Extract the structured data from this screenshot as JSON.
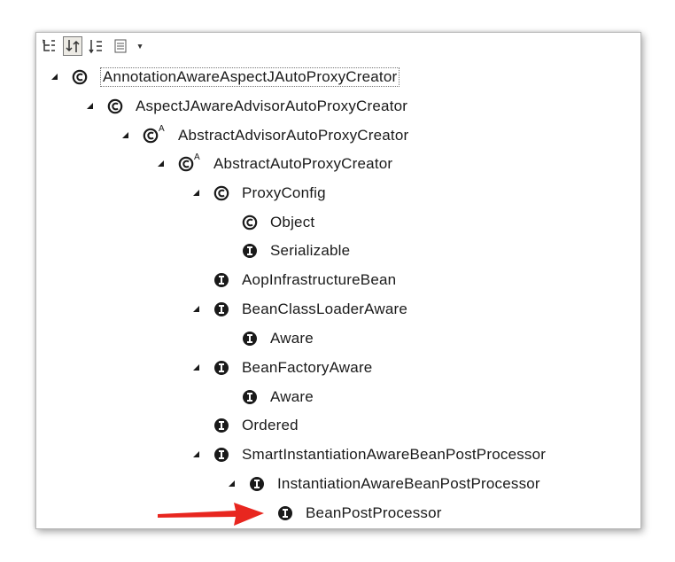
{
  "toolbar": {
    "buttons": [
      "show-qualified-names",
      "sort",
      "hide-non-public",
      "filter",
      "view-menu"
    ],
    "dropdown_glyph": "▾"
  },
  "tree": [
    {
      "label": "AnnotationAwareAspectJAutoProxyCreator",
      "icon": "class-icon",
      "expanded": true,
      "selected": true
    },
    {
      "label": "AspectJAwareAdvisorAutoProxyCreator",
      "icon": "class-icon",
      "expanded": true
    },
    {
      "label": "AbstractAdvisorAutoProxyCreator",
      "icon": "abstract-class-icon",
      "expanded": true
    },
    {
      "label": "AbstractAutoProxyCreator",
      "icon": "abstract-class-icon",
      "expanded": true
    },
    {
      "label": "ProxyConfig",
      "icon": "class-icon",
      "expanded": true
    },
    {
      "label": "Object",
      "icon": "class-icon"
    },
    {
      "label": "Serializable",
      "icon": "interface-icon"
    },
    {
      "label": "AopInfrastructureBean",
      "icon": "interface-icon"
    },
    {
      "label": "BeanClassLoaderAware",
      "icon": "interface-icon",
      "expanded": true
    },
    {
      "label": "Aware",
      "icon": "interface-icon"
    },
    {
      "label": "BeanFactoryAware",
      "icon": "interface-icon",
      "expanded": true
    },
    {
      "label": "Aware",
      "icon": "interface-icon"
    },
    {
      "label": "Ordered",
      "icon": "interface-icon"
    },
    {
      "label": "SmartInstantiationAwareBeanPostProcessor",
      "icon": "interface-icon",
      "expanded": true
    },
    {
      "label": "InstantiationAwareBeanPostProcessor",
      "icon": "interface-icon",
      "expanded": true
    },
    {
      "label": "BeanPostProcessor",
      "icon": "interface-icon",
      "highlighted_by_arrow": true
    }
  ],
  "abstract_marker": "A",
  "colors": {
    "arrow": "#e8261f",
    "icon": "#1a1a1a"
  }
}
